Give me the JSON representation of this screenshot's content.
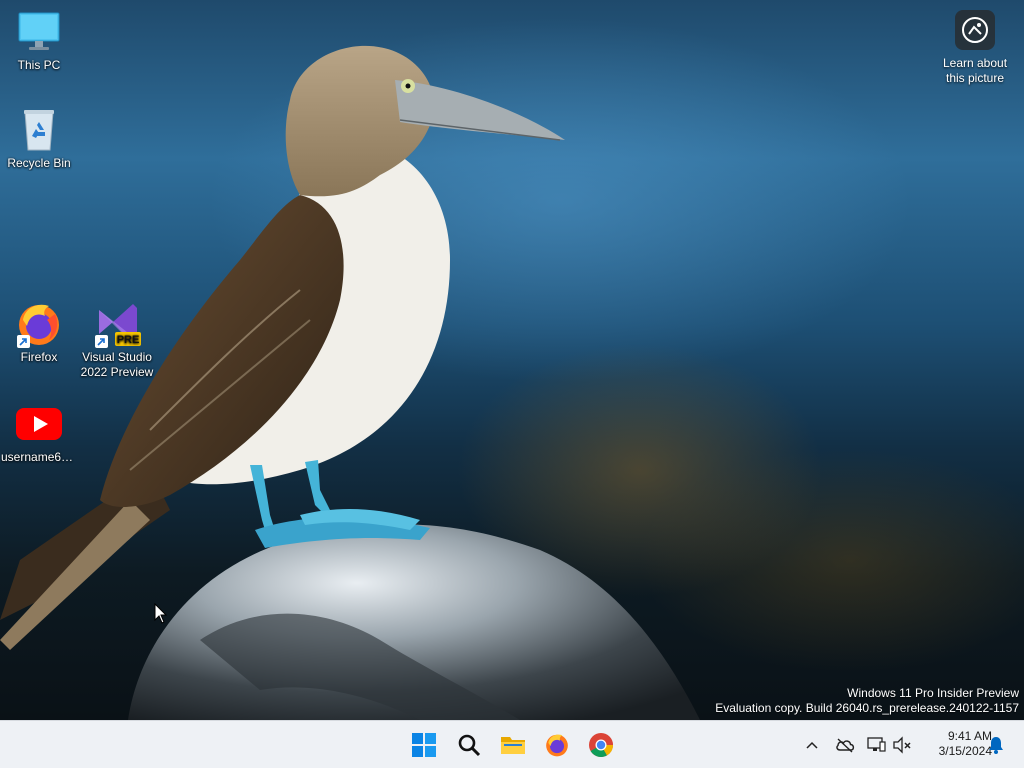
{
  "desktop_icons": [
    {
      "label": "This PC",
      "icon": "monitor-icon"
    },
    {
      "label": "Recycle Bin",
      "icon": "recycle-bin-icon"
    },
    {
      "label": "Firefox",
      "icon": "firefox-icon"
    },
    {
      "label": "Visual Studio 2022 Preview",
      "icon": "visual-studio-preview-icon",
      "badge": "PRE"
    },
    {
      "label": "username66...",
      "icon": "youtube-icon"
    }
  ],
  "spotlight": {
    "label": "Learn about this picture",
    "icon": "camera-info-icon"
  },
  "watermark": {
    "line1": "Windows 11 Pro Insider Preview",
    "line2": "Evaluation copy. Build 26040.rs_prerelease.240122-1157"
  },
  "taskbar": {
    "apps": [
      {
        "name": "Start",
        "icon": "windows-start-icon"
      },
      {
        "name": "Search",
        "icon": "search-icon"
      },
      {
        "name": "File Explorer",
        "icon": "folder-icon"
      },
      {
        "name": "Firefox",
        "icon": "firefox-icon"
      },
      {
        "name": "Chrome",
        "icon": "chrome-icon"
      }
    ],
    "tray_icons": [
      "chevron-up-icon",
      "cloud-offline-icon",
      "network-icon",
      "speaker-muted-icon"
    ],
    "time": "9:41 AM",
    "date": "3/15/2024",
    "notification_icon": "bell-icon"
  },
  "colors": {
    "taskbar_bg": "#eef1f5",
    "accent_blue": "#0067c0",
    "youtube_red": "#ff0000"
  }
}
